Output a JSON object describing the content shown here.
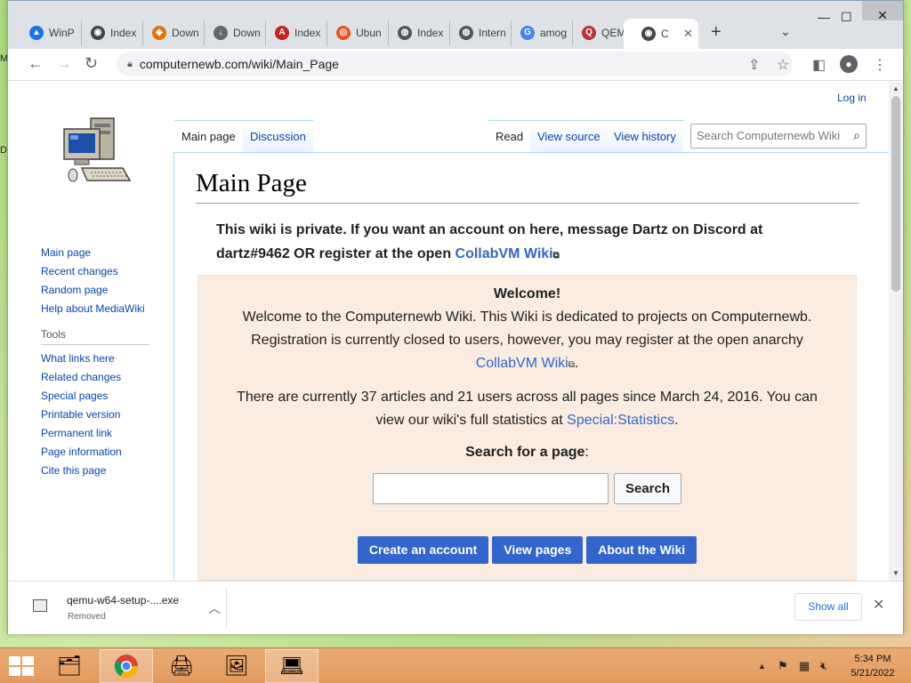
{
  "browser": {
    "tabs": [
      {
        "label": "WinP",
        "icon": "google-drive-icon",
        "color": "#1a73e8"
      },
      {
        "label": "Index",
        "icon": "collabvm-icon",
        "color": "#444444"
      },
      {
        "label": "Down",
        "icon": "diamond-icon",
        "color": "#e8710a"
      },
      {
        "label": "Down",
        "icon": "download-icon",
        "color": "#444444"
      },
      {
        "label": "Index",
        "icon": "arch-icon",
        "color": "#c5221f"
      },
      {
        "label": "Ubun",
        "icon": "ubuntu-icon",
        "color": "#e95420"
      },
      {
        "label": "Index",
        "icon": "globe-icon",
        "color": "#555555"
      },
      {
        "label": "Intern",
        "icon": "globe-icon",
        "color": "#555555"
      },
      {
        "label": "amog",
        "icon": "google-icon",
        "color": "#4285f4"
      },
      {
        "label": "QEMU",
        "icon": "qemu-icon",
        "color": "#b33"
      },
      {
        "label": "C",
        "icon": "collabvm-icon",
        "color": "#444444"
      }
    ],
    "url": "computernewb.com/wiki/Main_Page"
  },
  "wiki": {
    "login": "Log in",
    "sidebar": {
      "nav": [
        "Main page",
        "Recent changes",
        "Random page",
        "Help about MediaWiki"
      ],
      "tools_heading": "Tools",
      "tools": [
        "What links here",
        "Related changes",
        "Special pages",
        "Printable version",
        "Permanent link",
        "Page information",
        "Cite this page"
      ]
    },
    "tabs": {
      "main_page": "Main page",
      "discussion": "Discussion",
      "read": "Read",
      "view_source": "View source",
      "view_history": "View history"
    },
    "search_placeholder": "Search Computernewb Wiki",
    "title": "Main Page",
    "notice_text": "This wiki is private. If you want an account on here, message Dartz on Discord at dartz#9462 OR register at the open ",
    "notice_link": "CollabVM Wiki",
    "welcome": {
      "title": "Welcome!",
      "p1_line1": "Welcome to the Computernewb Wiki. This Wiki is dedicated to projects on Computernewb.",
      "p1_line2": "Registration is currently closed to users, however, you may register at the open anarchy",
      "p1_link": "CollabVM Wiki",
      "p1_end": ".",
      "p2_text": "There are currently 37 articles and 21 users across all pages since March 24, 2016. You can view our wiki's full statistics at ",
      "p2_link": "Special:Statistics",
      "p2_end": ".",
      "search_title": "Search for a page",
      "search_colon": ":",
      "search_button": "Search",
      "buttons": {
        "create": "Create an account",
        "view": "View pages",
        "about": "About the Wiki"
      }
    }
  },
  "download": {
    "filename": "qemu-w64-setup-....exe",
    "status": "Removed",
    "show_all": "Show all"
  },
  "taskbar": {
    "time": "5:34 PM",
    "date": "5/21/2022"
  }
}
